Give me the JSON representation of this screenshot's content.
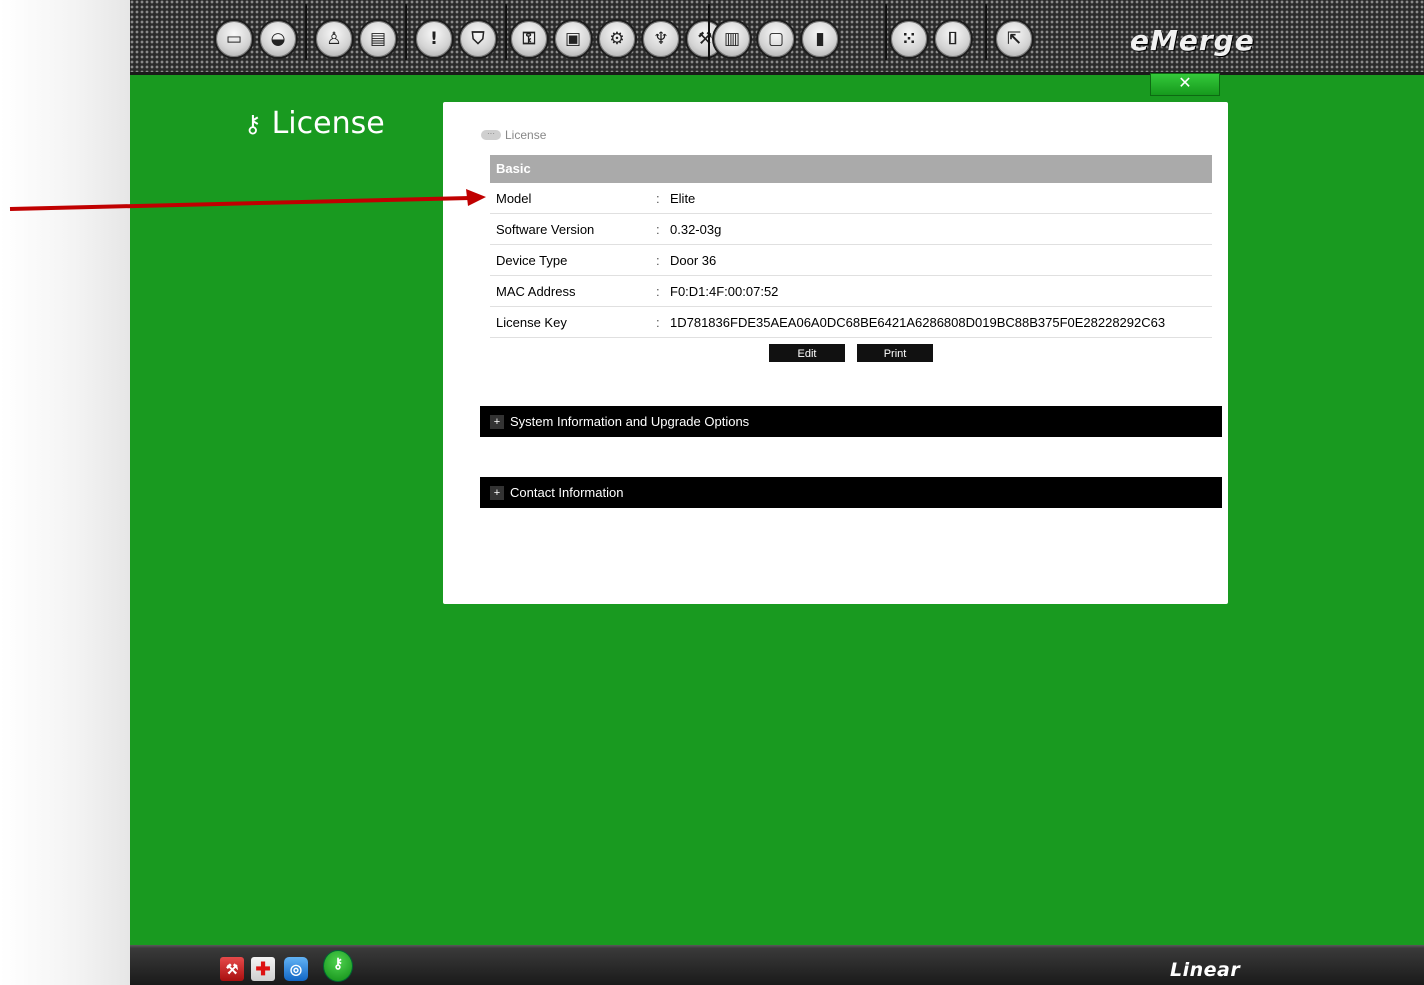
{
  "toolbar": {
    "icons": [
      {
        "name": "monitor-icon",
        "glyph": "▭"
      },
      {
        "name": "camera-icon",
        "glyph": "◒"
      },
      {
        "name": "person-icon",
        "glyph": "♙"
      },
      {
        "name": "id-card-icon",
        "glyph": "▤"
      },
      {
        "name": "alert-icon",
        "glyph": "!"
      },
      {
        "name": "shield-icon",
        "glyph": "⛉"
      },
      {
        "name": "door-settings-icon",
        "glyph": "⚿"
      },
      {
        "name": "badge-settings-icon",
        "glyph": "▣"
      },
      {
        "name": "gears-icon",
        "glyph": "⚙"
      },
      {
        "name": "network-settings-icon",
        "glyph": "♆"
      },
      {
        "name": "floor-settings-icon",
        "glyph": "⚒"
      },
      {
        "name": "save-icon",
        "glyph": "▥"
      },
      {
        "name": "report-icon",
        "glyph": "▢"
      },
      {
        "name": "chart-icon",
        "glyph": "▮"
      },
      {
        "name": "keypad-icon",
        "glyph": "⁙"
      },
      {
        "name": "door-icon",
        "glyph": "⌷"
      },
      {
        "name": "exit-icon",
        "glyph": "⇱"
      }
    ],
    "brand": "eMerge",
    "close_label": "✕"
  },
  "page_title": "License",
  "breadcrumb": "License",
  "basic": {
    "header": "Basic",
    "rows": [
      {
        "label": "Model",
        "sep": ":",
        "value": "Elite"
      },
      {
        "label": "Software Version",
        "sep": ":",
        "value": "0.32-03g"
      },
      {
        "label": "Device Type",
        "sep": ":",
        "value": "Door 36"
      },
      {
        "label": "MAC Address",
        "sep": ":",
        "value": "F0:D1:4F:00:07:52"
      },
      {
        "label": "License Key",
        "sep": ":",
        "value": "1D781836FDE35AEA06A0DC68BE6421A6286808D019BC88B375F0E28228292C63"
      }
    ],
    "edit_label": "Edit",
    "print_label": "Print"
  },
  "sections": {
    "system_info": {
      "plus": "+",
      "label": "System Information and Upgrade Options"
    },
    "contact_info": {
      "plus": "+",
      "label": "Contact Information"
    }
  },
  "bottom": {
    "brand": "Linear",
    "buttons": [
      {
        "name": "tools-icon",
        "glyph": "⚒"
      },
      {
        "name": "help-cross-icon",
        "glyph": "✚"
      },
      {
        "name": "compass-icon",
        "glyph": "◎"
      },
      {
        "name": "license-key-icon",
        "glyph": "⚷"
      }
    ]
  },
  "colors": {
    "main_green": "#199a20",
    "annotation_arrow": "#c00000"
  }
}
